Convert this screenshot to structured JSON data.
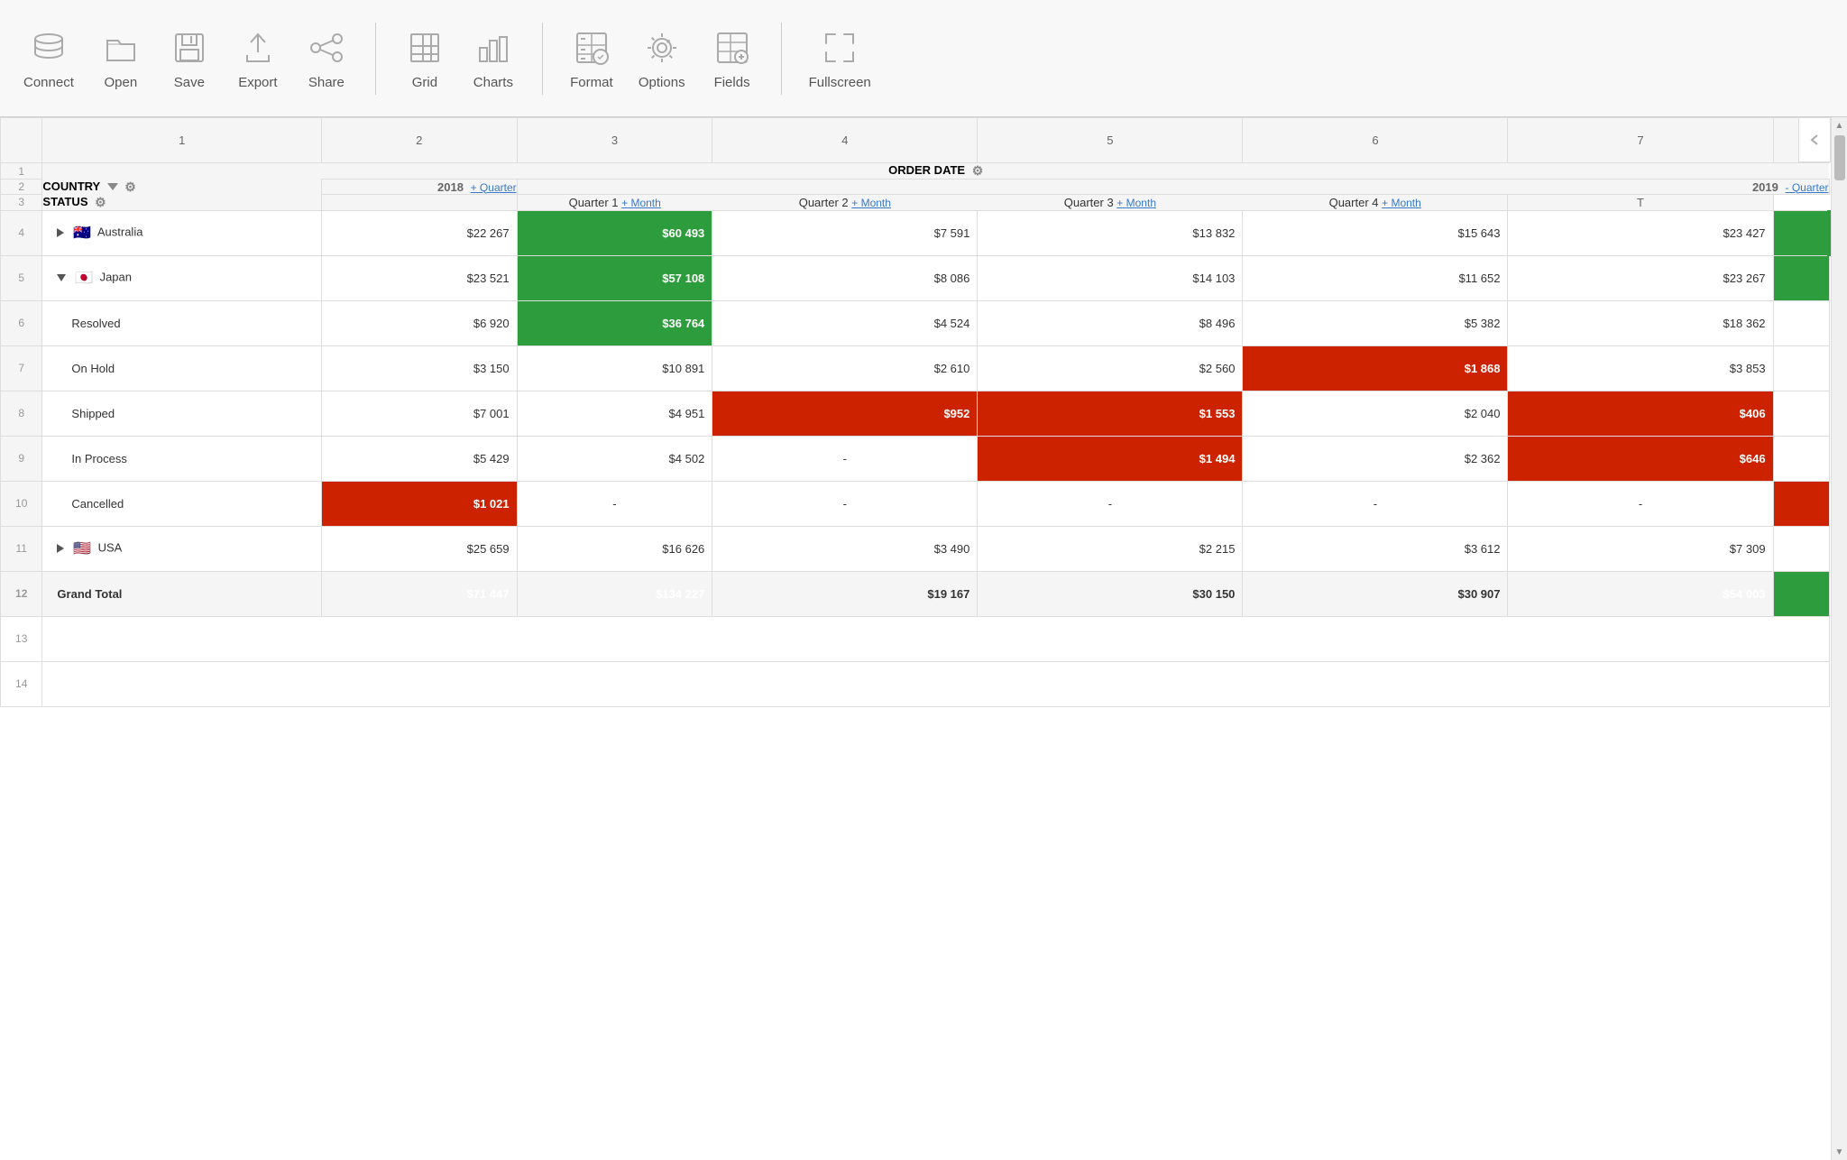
{
  "toolbar": {
    "items": [
      {
        "id": "connect",
        "label": "Connect",
        "icon": "database"
      },
      {
        "id": "open",
        "label": "Open",
        "icon": "folder"
      },
      {
        "id": "save",
        "label": "Save",
        "icon": "save"
      },
      {
        "id": "export",
        "label": "Export",
        "icon": "export"
      },
      {
        "id": "share",
        "label": "Share",
        "icon": "share"
      },
      {
        "id": "grid",
        "label": "Grid",
        "icon": "grid"
      },
      {
        "id": "charts",
        "label": "Charts",
        "icon": "charts"
      },
      {
        "id": "format",
        "label": "Format",
        "icon": "format"
      },
      {
        "id": "options",
        "label": "Options",
        "icon": "options"
      },
      {
        "id": "fields",
        "label": "Fields",
        "icon": "fields"
      },
      {
        "id": "fullscreen",
        "label": "Fullscreen",
        "icon": "fullscreen"
      }
    ]
  },
  "grid": {
    "col_numbers": [
      "1",
      "2",
      "3",
      "4",
      "5",
      "6",
      "7"
    ],
    "headers": {
      "order_date": "ORDER DATE",
      "country": "COUNTRY",
      "status": "STATUS",
      "year_2018": "2018",
      "year_2019": "2019",
      "quarter_label": "Quarter",
      "plus_quarter": "+ Quarter",
      "minus_quarter": "- Quarter",
      "q1": "Quarter 1",
      "q2": "Quarter 2",
      "q3": "Quarter 3",
      "q4": "Quarter 4",
      "plus_month": "+ Month"
    },
    "rows": [
      {
        "num": "4",
        "label": "Australia",
        "flag": "🇦🇺",
        "expandable": true,
        "expanded": false,
        "val_2018": "$22 267",
        "val_2019": "$60 493",
        "val_2019_style": "green",
        "q1": "$7 591",
        "q2": "$13 832",
        "q3": "$15 643",
        "q4": "$23 427",
        "total_style": "green"
      },
      {
        "num": "5",
        "label": "Japan",
        "flag": "🇯🇵",
        "expandable": true,
        "expanded": true,
        "val_2018": "$23 521",
        "val_2019": "$57 108",
        "val_2019_style": "green",
        "q1": "$8 086",
        "q2": "$14 103",
        "q3": "$11 652",
        "q4": "$23 267",
        "total_style": "green"
      },
      {
        "num": "6",
        "label": "Resolved",
        "indent": true,
        "val_2018": "$6 920",
        "val_2019": "$36 764",
        "val_2019_style": "green",
        "q1": "$4 524",
        "q2": "$8 496",
        "q3": "$5 382",
        "q4": "$18 362",
        "total_style": "none"
      },
      {
        "num": "7",
        "label": "On Hold",
        "indent": true,
        "val_2018": "$3 150",
        "val_2019": "$10 891",
        "val_2019_style": "none",
        "q1": "$2 610",
        "q2": "$2 560",
        "q3": "$1 868",
        "q3_style": "red",
        "q4": "$3 853",
        "total_style": "none"
      },
      {
        "num": "8",
        "label": "Shipped",
        "indent": true,
        "val_2018": "$7 001",
        "val_2019": "$4 951",
        "val_2019_style": "none",
        "q1": "$952",
        "q1_style": "red",
        "q2": "$1 553",
        "q2_style": "red",
        "q3": "$2 040",
        "q4": "$406",
        "q4_style": "red",
        "total_style": "none"
      },
      {
        "num": "9",
        "label": "In Process",
        "indent": true,
        "val_2018": "$5 429",
        "val_2019": "$4 502",
        "val_2019_style": "none",
        "q1": "-",
        "q1_dash": true,
        "q2": "$1 494",
        "q2_style": "red",
        "q3": "$2 362",
        "q4": "$646",
        "q4_style": "red",
        "total_style": "none"
      },
      {
        "num": "10",
        "label": "Cancelled",
        "indent": true,
        "val_2018": "$1 021",
        "val_2018_style": "red",
        "val_2019": "-",
        "val_2019_dash": true,
        "q1": "-",
        "q1_dash": true,
        "q2": "-",
        "q2_dash": true,
        "q3": "-",
        "q3_dash": true,
        "q4": "-",
        "q4_dash": true,
        "total_style": "red"
      },
      {
        "num": "11",
        "label": "USA",
        "flag": "🇺🇸",
        "expandable": true,
        "expanded": false,
        "val_2018": "$25 659",
        "val_2019": "$16 626",
        "val_2019_style": "none",
        "q1": "$3 490",
        "q2": "$2 215",
        "q3": "$3 612",
        "q4": "$7 309",
        "total_style": "none"
      },
      {
        "num": "12",
        "label": "Grand Total",
        "grand_total": true,
        "val_2018": "$71 447",
        "val_2018_style": "green",
        "val_2019": "$134 227",
        "val_2019_style": "green",
        "q1": "$19 167",
        "q2": "$30 150",
        "q3": "$30 907",
        "q4": "$54 003",
        "q4_style": "green",
        "total_style": "green"
      }
    ],
    "empty_rows": [
      "13",
      "14"
    ]
  }
}
